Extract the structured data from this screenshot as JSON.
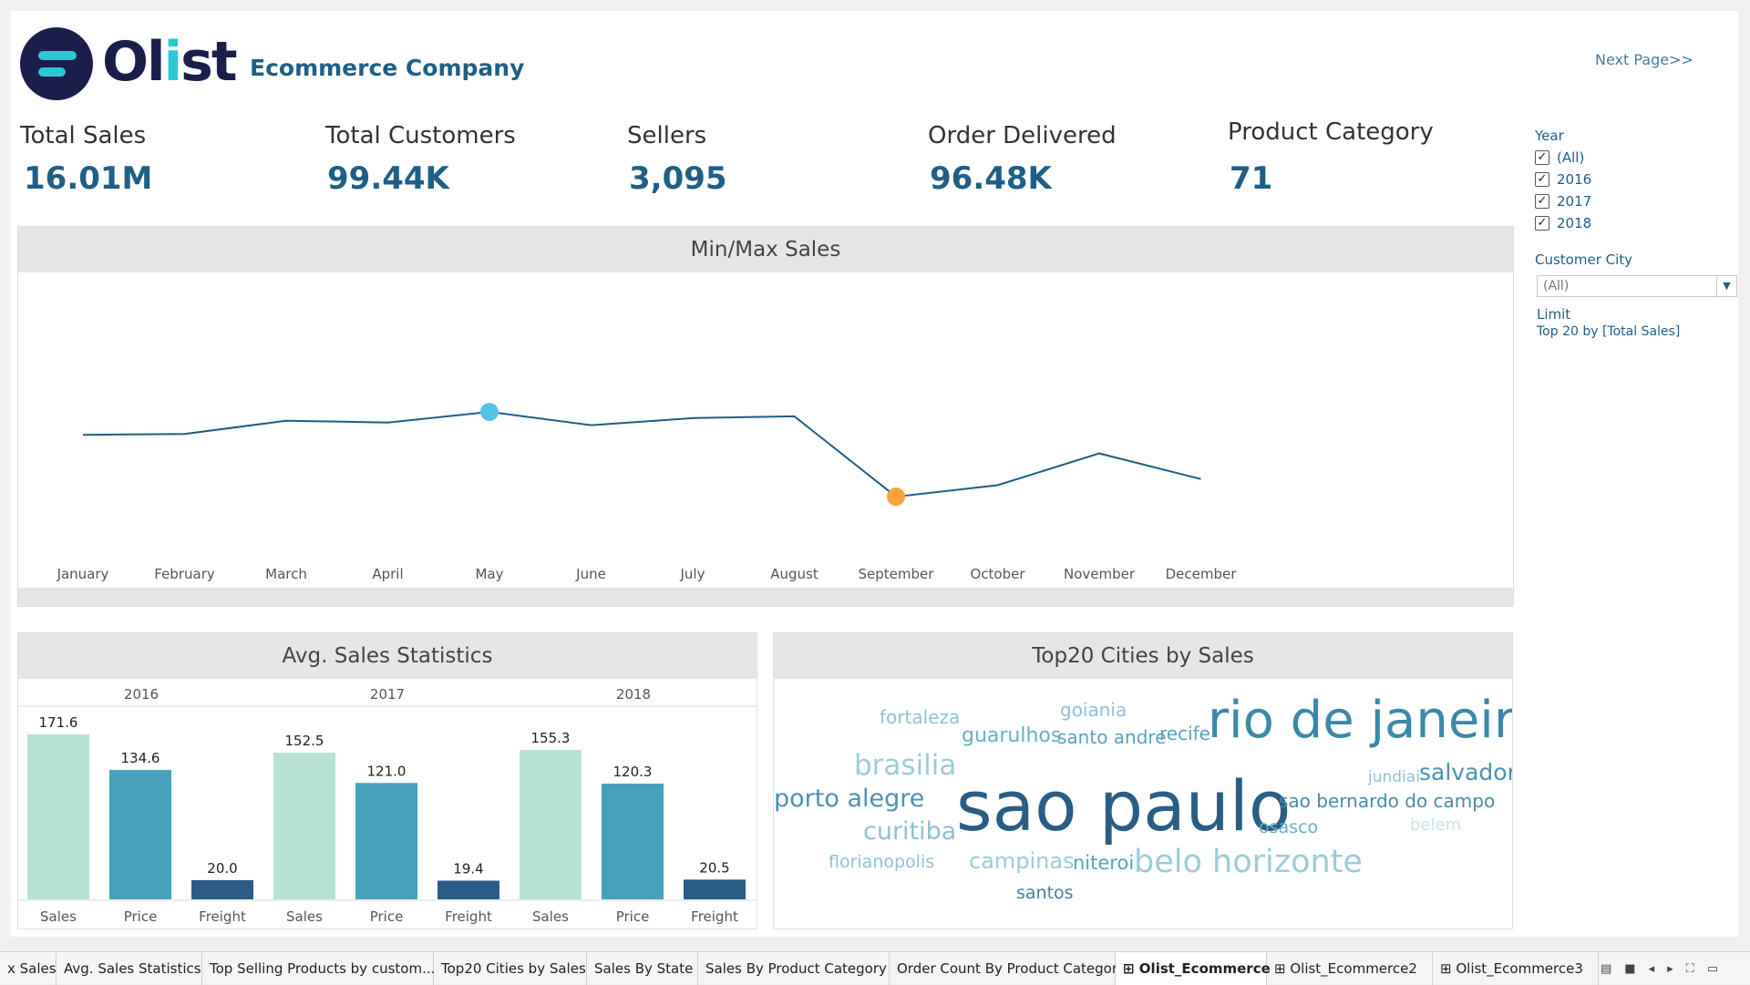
{
  "header": {
    "logo_text_pre": "Ol",
    "logo_text_i": "i",
    "logo_text_post": "st",
    "company": "Ecommerce Company",
    "next_page": "Next Page>>"
  },
  "kpis": [
    {
      "label": "Total Sales",
      "value": "16.01M"
    },
    {
      "label": "Total Customers",
      "value": "99.44K"
    },
    {
      "label": "Sellers",
      "value": "3,095"
    },
    {
      "label": "Order Delivered",
      "value": "96.48K"
    },
    {
      "label": "Product Category",
      "value": "71"
    }
  ],
  "filters": {
    "year_title": "Year",
    "year_options": [
      {
        "label": "(All)",
        "checked": true
      },
      {
        "label": "2016",
        "checked": true
      },
      {
        "label": "2017",
        "checked": true
      },
      {
        "label": "2018",
        "checked": true
      }
    ],
    "city_title": "Customer City",
    "city_value": "(All)",
    "limit_title": "Limit",
    "limit_value": "Top 20 by [Total Sales]"
  },
  "colors": {
    "accent": "#1f5f87",
    "line": "#1d5d87",
    "max_point": "#55c2e8",
    "min_point": "#f7a23a",
    "bar_sales": "#b8e1d6",
    "bar_price": "#46a2bb",
    "bar_freight": "#2b5b87"
  },
  "chart_data": [
    {
      "type": "line",
      "title": "Min/Max Sales",
      "categories": [
        "January",
        "February",
        "March",
        "April",
        "May",
        "June",
        "July",
        "August",
        "September",
        "October",
        "November",
        "December"
      ],
      "values": [
        1.36,
        1.37,
        1.52,
        1.5,
        1.62,
        1.47,
        1.55,
        1.57,
        0.66,
        0.79,
        1.15,
        0.86
      ],
      "max_index": 4,
      "min_index": 8,
      "ylim": [
        0,
        3.2
      ],
      "grid": false
    },
    {
      "type": "bar",
      "title": "Avg. Sales Statistics",
      "groups": [
        "2016",
        "2017",
        "2018"
      ],
      "categories": [
        "Sales",
        "Price",
        "Freight"
      ],
      "series": [
        {
          "name": "2016",
          "values": [
            171.6,
            134.6,
            20.0
          ]
        },
        {
          "name": "2017",
          "values": [
            152.5,
            121.0,
            19.4
          ]
        },
        {
          "name": "2018",
          "values": [
            155.3,
            120.3,
            20.5
          ]
        }
      ],
      "labels": [
        [
          "171.6",
          "134.6",
          "20.0"
        ],
        [
          "152.5",
          "121.0",
          "19.4"
        ],
        [
          "155.3",
          "120.3",
          "20.5"
        ]
      ],
      "ylim": [
        0,
        180
      ]
    }
  ],
  "wordcloud": {
    "title": "Top20 Cities by Sales",
    "words": [
      {
        "text": "fortaleza",
        "color": "#8fc1d3"
      },
      {
        "text": "goiania",
        "color": "#8fc1d3"
      },
      {
        "text": "rio de janeiro",
        "color": "#3b88aa"
      },
      {
        "text": "guarulhos",
        "color": "#6aaec4"
      },
      {
        "text": "santo andre",
        "color": "#5aa2bd"
      },
      {
        "text": "recife",
        "color": "#5aa2bd"
      },
      {
        "text": "brasilia",
        "color": "#9ccbd9"
      },
      {
        "text": "jundiai",
        "color": "#8fc1d3"
      },
      {
        "text": "salvador",
        "color": "#4b92b2"
      },
      {
        "text": "porto alegre",
        "color": "#4b92b2"
      },
      {
        "text": "sao paulo",
        "color": "#2a5d84"
      },
      {
        "text": "sao bernardo do campo",
        "color": "#4b8aa8"
      },
      {
        "text": "curitiba",
        "color": "#8fc1d3"
      },
      {
        "text": "osasco",
        "color": "#6aaec4"
      },
      {
        "text": "belem",
        "color": "#c9e6e8"
      },
      {
        "text": "florianopolis",
        "color": "#8fc1d3"
      },
      {
        "text": "campinas",
        "color": "#9ccbd9"
      },
      {
        "text": "niteroi",
        "color": "#5aa2bd"
      },
      {
        "text": "belo horizonte",
        "color": "#9ccbd9"
      },
      {
        "text": "santos",
        "color": "#4b7ea0"
      }
    ]
  },
  "tabs": [
    {
      "label": "x Sales",
      "icon": ""
    },
    {
      "label": "Avg. Sales Statistics",
      "icon": ""
    },
    {
      "label": "Top Selling Products by custom...",
      "icon": ""
    },
    {
      "label": "Top20 Cities by Sales",
      "icon": ""
    },
    {
      "label": "Sales By State",
      "icon": ""
    },
    {
      "label": "Sales By Product Category",
      "icon": ""
    },
    {
      "label": "Order Count By Product Category",
      "icon": ""
    },
    {
      "label": "Olist_Ecommerce",
      "icon": "dashboard-grid-icon",
      "active": true
    },
    {
      "label": "Olist_Ecommerce2",
      "icon": "dashboard-grid-icon"
    },
    {
      "label": "Olist_Ecommerce3",
      "icon": "dashboard-grid-icon"
    }
  ]
}
